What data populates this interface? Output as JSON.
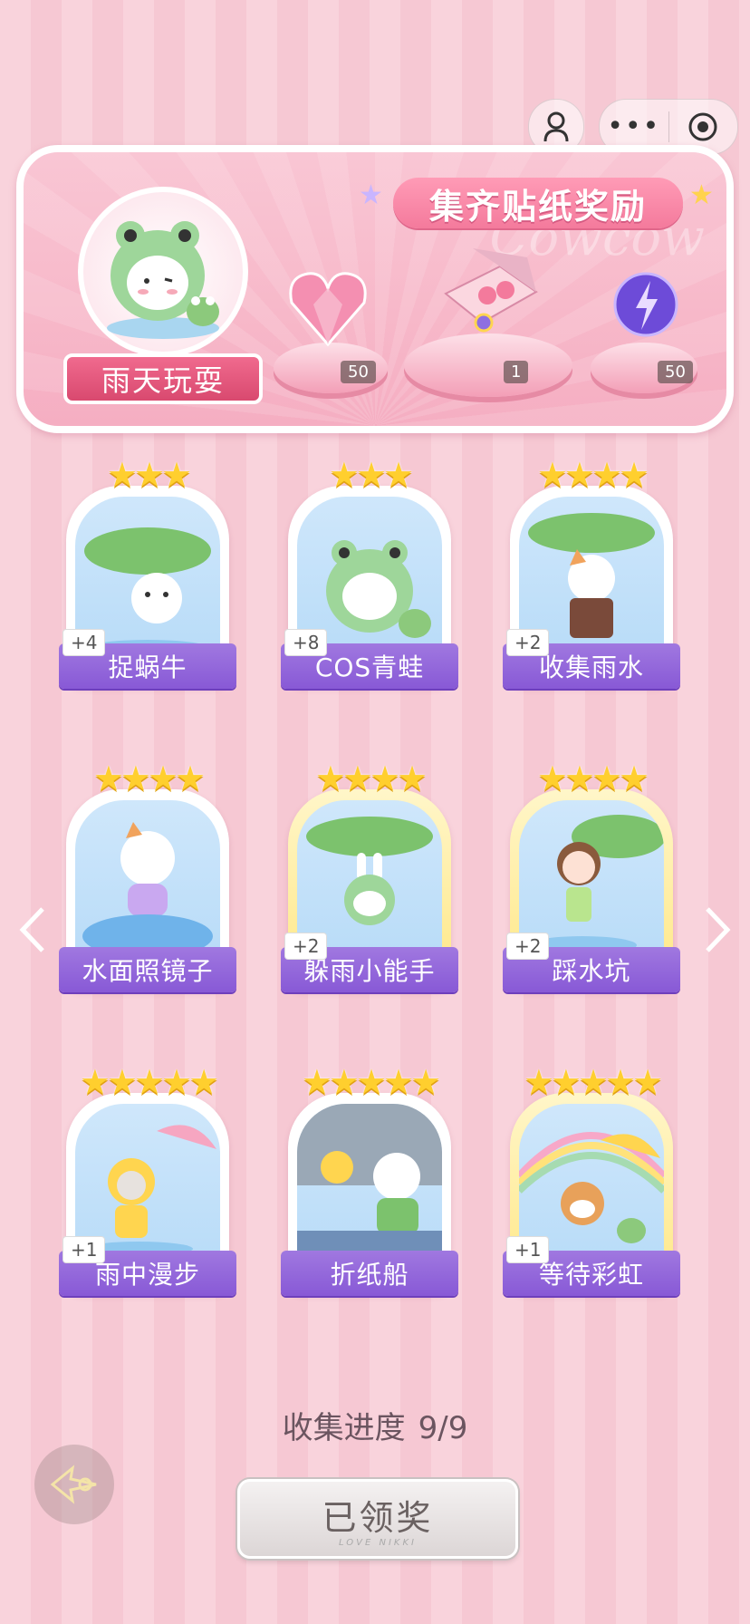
{
  "banner": {
    "title": "集齐贴纸奖励",
    "watermark": "Cowcow",
    "theme_name": "雨天玩耍",
    "rewards": [
      {
        "icon": "pink-diamond-heart-icon",
        "count": "50"
      },
      {
        "icon": "gift-box-icon",
        "count": "1"
      },
      {
        "icon": "energy-orb-icon",
        "count": "50"
      }
    ]
  },
  "stickers": [
    {
      "name": "捉蜗牛",
      "stars": 3,
      "bonus": "+4",
      "frame": "white",
      "art": "puppy-lotus-leaf"
    },
    {
      "name": "COS青蛙",
      "stars": 3,
      "bonus": "+8",
      "frame": "white",
      "art": "frog-costume-cat"
    },
    {
      "name": "收集雨水",
      "stars": 4,
      "bonus": "+2",
      "frame": "white",
      "art": "calico-cat-rain"
    },
    {
      "name": "水面照镜子",
      "stars": 4,
      "bonus": "",
      "frame": "white",
      "art": "cat-reflection"
    },
    {
      "name": "躲雨小能手",
      "stars": 4,
      "bonus": "+2",
      "frame": "gold",
      "art": "bunny-frog-leaf"
    },
    {
      "name": "踩水坑",
      "stars": 4,
      "bonus": "+2",
      "frame": "gold",
      "art": "girl-puddle"
    },
    {
      "name": "雨中漫步",
      "stars": 5,
      "bonus": "+1",
      "frame": "white",
      "art": "duck-cat-umbrella"
    },
    {
      "name": "折纸船",
      "stars": 5,
      "bonus": "",
      "frame": "white",
      "art": "bear-paper-boat"
    },
    {
      "name": "等待彩虹",
      "stars": 5,
      "bonus": "+1",
      "frame": "gold",
      "art": "shiba-rainbow"
    }
  ],
  "progress": {
    "label": "收集进度",
    "value": "9/9"
  },
  "claim_button": {
    "label": "已领奖",
    "sub": "LOVE NIKKI"
  },
  "colors": {
    "label_bar": "#8859d6",
    "star": "#ffcf2e",
    "banner_title": "#f47a9c"
  }
}
